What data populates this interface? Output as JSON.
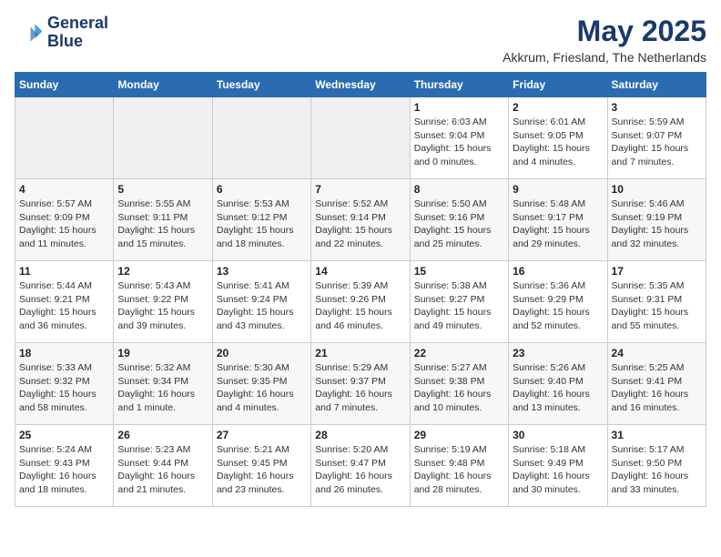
{
  "header": {
    "logo_line1": "General",
    "logo_line2": "Blue",
    "month_year": "May 2025",
    "location": "Akkrum, Friesland, The Netherlands"
  },
  "days_of_week": [
    "Sunday",
    "Monday",
    "Tuesday",
    "Wednesday",
    "Thursday",
    "Friday",
    "Saturday"
  ],
  "weeks": [
    [
      {
        "day": "",
        "info": ""
      },
      {
        "day": "",
        "info": ""
      },
      {
        "day": "",
        "info": ""
      },
      {
        "day": "",
        "info": ""
      },
      {
        "day": "1",
        "info": "Sunrise: 6:03 AM\nSunset: 9:04 PM\nDaylight: 15 hours\nand 0 minutes."
      },
      {
        "day": "2",
        "info": "Sunrise: 6:01 AM\nSunset: 9:05 PM\nDaylight: 15 hours\nand 4 minutes."
      },
      {
        "day": "3",
        "info": "Sunrise: 5:59 AM\nSunset: 9:07 PM\nDaylight: 15 hours\nand 7 minutes."
      }
    ],
    [
      {
        "day": "4",
        "info": "Sunrise: 5:57 AM\nSunset: 9:09 PM\nDaylight: 15 hours\nand 11 minutes."
      },
      {
        "day": "5",
        "info": "Sunrise: 5:55 AM\nSunset: 9:11 PM\nDaylight: 15 hours\nand 15 minutes."
      },
      {
        "day": "6",
        "info": "Sunrise: 5:53 AM\nSunset: 9:12 PM\nDaylight: 15 hours\nand 18 minutes."
      },
      {
        "day": "7",
        "info": "Sunrise: 5:52 AM\nSunset: 9:14 PM\nDaylight: 15 hours\nand 22 minutes."
      },
      {
        "day": "8",
        "info": "Sunrise: 5:50 AM\nSunset: 9:16 PM\nDaylight: 15 hours\nand 25 minutes."
      },
      {
        "day": "9",
        "info": "Sunrise: 5:48 AM\nSunset: 9:17 PM\nDaylight: 15 hours\nand 29 minutes."
      },
      {
        "day": "10",
        "info": "Sunrise: 5:46 AM\nSunset: 9:19 PM\nDaylight: 15 hours\nand 32 minutes."
      }
    ],
    [
      {
        "day": "11",
        "info": "Sunrise: 5:44 AM\nSunset: 9:21 PM\nDaylight: 15 hours\nand 36 minutes."
      },
      {
        "day": "12",
        "info": "Sunrise: 5:43 AM\nSunset: 9:22 PM\nDaylight: 15 hours\nand 39 minutes."
      },
      {
        "day": "13",
        "info": "Sunrise: 5:41 AM\nSunset: 9:24 PM\nDaylight: 15 hours\nand 43 minutes."
      },
      {
        "day": "14",
        "info": "Sunrise: 5:39 AM\nSunset: 9:26 PM\nDaylight: 15 hours\nand 46 minutes."
      },
      {
        "day": "15",
        "info": "Sunrise: 5:38 AM\nSunset: 9:27 PM\nDaylight: 15 hours\nand 49 minutes."
      },
      {
        "day": "16",
        "info": "Sunrise: 5:36 AM\nSunset: 9:29 PM\nDaylight: 15 hours\nand 52 minutes."
      },
      {
        "day": "17",
        "info": "Sunrise: 5:35 AM\nSunset: 9:31 PM\nDaylight: 15 hours\nand 55 minutes."
      }
    ],
    [
      {
        "day": "18",
        "info": "Sunrise: 5:33 AM\nSunset: 9:32 PM\nDaylight: 15 hours\nand 58 minutes."
      },
      {
        "day": "19",
        "info": "Sunrise: 5:32 AM\nSunset: 9:34 PM\nDaylight: 16 hours\nand 1 minute."
      },
      {
        "day": "20",
        "info": "Sunrise: 5:30 AM\nSunset: 9:35 PM\nDaylight: 16 hours\nand 4 minutes."
      },
      {
        "day": "21",
        "info": "Sunrise: 5:29 AM\nSunset: 9:37 PM\nDaylight: 16 hours\nand 7 minutes."
      },
      {
        "day": "22",
        "info": "Sunrise: 5:27 AM\nSunset: 9:38 PM\nDaylight: 16 hours\nand 10 minutes."
      },
      {
        "day": "23",
        "info": "Sunrise: 5:26 AM\nSunset: 9:40 PM\nDaylight: 16 hours\nand 13 minutes."
      },
      {
        "day": "24",
        "info": "Sunrise: 5:25 AM\nSunset: 9:41 PM\nDaylight: 16 hours\nand 16 minutes."
      }
    ],
    [
      {
        "day": "25",
        "info": "Sunrise: 5:24 AM\nSunset: 9:43 PM\nDaylight: 16 hours\nand 18 minutes."
      },
      {
        "day": "26",
        "info": "Sunrise: 5:23 AM\nSunset: 9:44 PM\nDaylight: 16 hours\nand 21 minutes."
      },
      {
        "day": "27",
        "info": "Sunrise: 5:21 AM\nSunset: 9:45 PM\nDaylight: 16 hours\nand 23 minutes."
      },
      {
        "day": "28",
        "info": "Sunrise: 5:20 AM\nSunset: 9:47 PM\nDaylight: 16 hours\nand 26 minutes."
      },
      {
        "day": "29",
        "info": "Sunrise: 5:19 AM\nSunset: 9:48 PM\nDaylight: 16 hours\nand 28 minutes."
      },
      {
        "day": "30",
        "info": "Sunrise: 5:18 AM\nSunset: 9:49 PM\nDaylight: 16 hours\nand 30 minutes."
      },
      {
        "day": "31",
        "info": "Sunrise: 5:17 AM\nSunset: 9:50 PM\nDaylight: 16 hours\nand 33 minutes."
      }
    ]
  ]
}
